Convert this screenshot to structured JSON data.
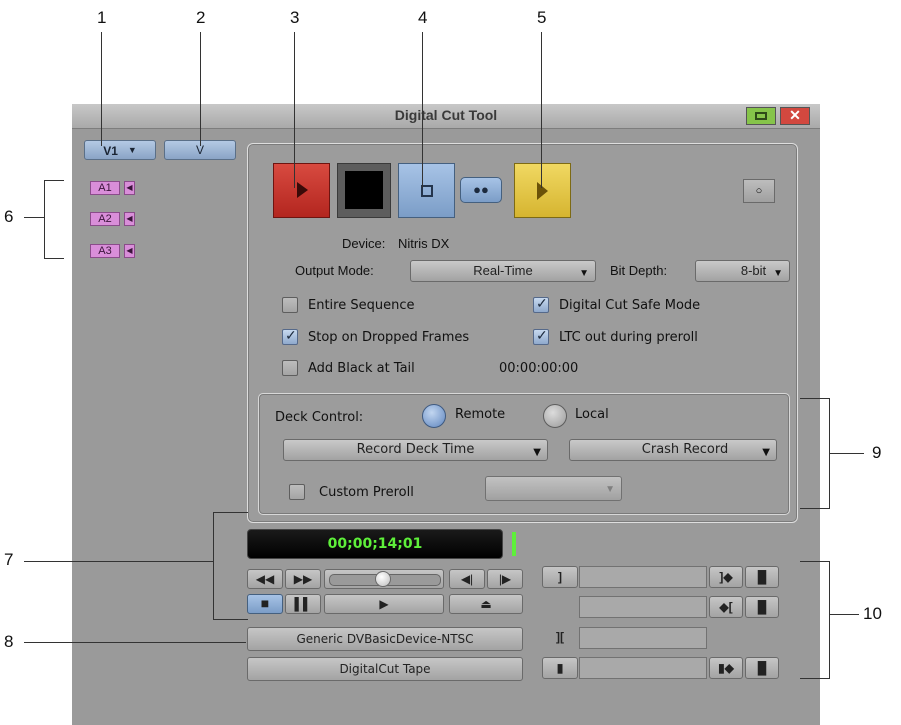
{
  "callouts": {
    "c1": "1",
    "c2": "2",
    "c3": "3",
    "c4": "4",
    "c5": "5",
    "c6": "6",
    "c7": "7",
    "c8": "8",
    "c9": "9",
    "c10": "10"
  },
  "window": {
    "title": "Digital Cut Tool"
  },
  "tracks": {
    "video_track": "V1",
    "video_selector": "V",
    "audio": [
      "A1",
      "A2",
      "A3"
    ]
  },
  "device": {
    "label": "Device:",
    "value": "Nitris DX"
  },
  "output_mode": {
    "label": "Output Mode:",
    "value": "Real-Time"
  },
  "bit_depth": {
    "label": "Bit Depth:",
    "value": "8-bit"
  },
  "options": {
    "entire_sequence": {
      "label": "Entire Sequence",
      "checked": false
    },
    "safe_mode": {
      "label": "Digital Cut Safe Mode",
      "checked": true
    },
    "stop_dropped": {
      "label": "Stop on Dropped Frames",
      "checked": true
    },
    "ltc_out": {
      "label": "LTC out during preroll",
      "checked": true
    },
    "add_black": {
      "label": "Add Black at Tail",
      "checked": false
    },
    "black_duration": "00:00:00:00"
  },
  "deck_control": {
    "label": "Deck Control:",
    "remote": "Remote",
    "local": "Local",
    "time_mode": "Record Deck Time",
    "record_mode": "Crash Record",
    "custom_preroll": "Custom Preroll"
  },
  "timecode": "00;00;14;01",
  "deck_name": "Generic DVBasicDevice-NTSC",
  "tape_name": "DigitalCut Tape",
  "colors": {
    "record_red": "#c9312b",
    "stop_blue": "#8fb0d8",
    "play_yellow": "#e9cc45",
    "timecode_green": "#5ef03a",
    "track_purple": "#d98ed9"
  }
}
